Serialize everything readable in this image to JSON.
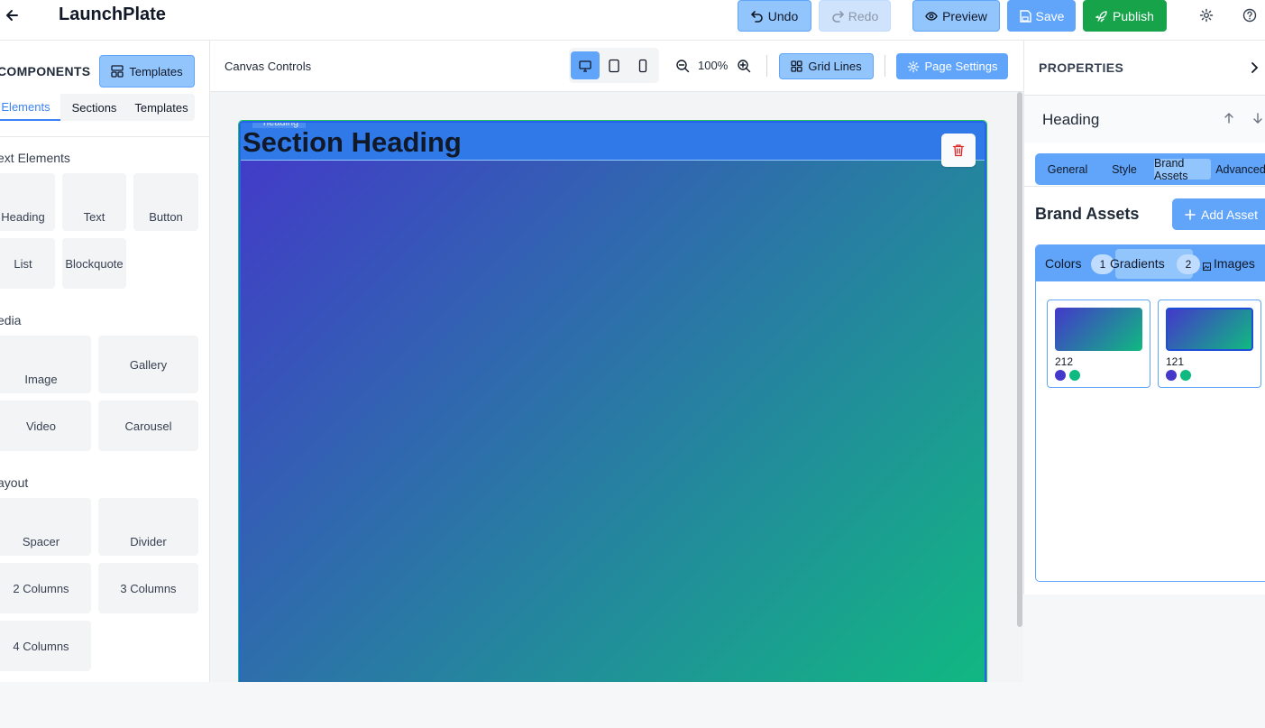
{
  "app": {
    "title": "LaunchPlate"
  },
  "toolbar": {
    "undo": "Undo",
    "redo": "Redo",
    "preview": "Preview",
    "save": "Save",
    "publish": "Publish",
    "icons": [
      "back-arrow-icon",
      "undo-icon",
      "redo-icon",
      "eye-icon",
      "save-icon",
      "rocket-icon",
      "gear-icon",
      "help-icon"
    ]
  },
  "left": {
    "title": "COMPONENTS",
    "templates_button": "Templates",
    "tabs": [
      "Elements",
      "Sections",
      "Templates"
    ],
    "active_tab": "Elements",
    "sections": [
      {
        "label": "ext Elements",
        "items": [
          "Heading",
          "Text",
          "Button",
          "List",
          "Blockquote"
        ]
      },
      {
        "label": "edia",
        "items": [
          "Image",
          "Gallery",
          "Video",
          "Carousel"
        ]
      },
      {
        "label": "ayout",
        "items": [
          "Spacer",
          "Divider",
          "2 Columns",
          "3 Columns",
          "4 Columns"
        ]
      }
    ]
  },
  "canvas": {
    "controls_label": "Canvas Controls",
    "zoom": "100%",
    "grid_button": "Grid Lines",
    "page_settings": "Page Settings",
    "heading_tag": "heading",
    "heading_text": "Section Heading",
    "gradient": [
      "#4338ca",
      "#10b981"
    ]
  },
  "properties": {
    "title": "PROPERTIES",
    "element": "Heading",
    "tabs": [
      "General",
      "Style",
      "Brand Assets",
      "Advanced"
    ],
    "active_tab": "Brand Assets",
    "brand_assets_title": "Brand Assets",
    "add_asset": "Add Asset",
    "asset_tabs": {
      "colors": "Colors",
      "colors_count": "1",
      "gradients": "Gradients",
      "gradients_count": "2",
      "images": "Images"
    },
    "gradients": [
      {
        "name": "212",
        "colors": [
          "#4338ca",
          "#10b981"
        ]
      },
      {
        "name": "121",
        "colors": [
          "#4338ca",
          "#10b981"
        ]
      }
    ]
  },
  "colors": {
    "accent": "#60a5fa",
    "accent_light": "#93c5fd",
    "publish": "#16a34a",
    "selection": "#2563eb"
  }
}
